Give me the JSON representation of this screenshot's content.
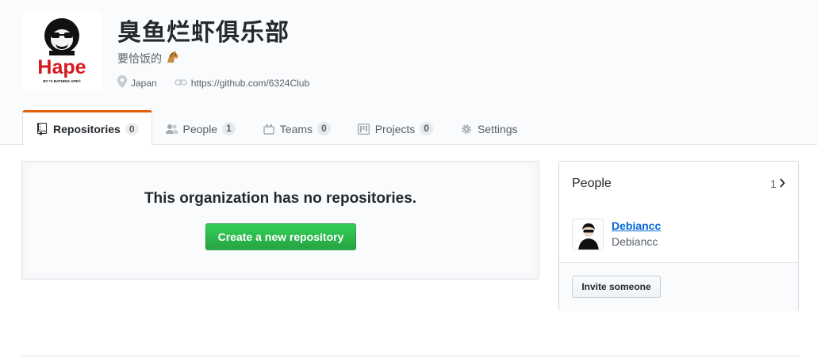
{
  "org": {
    "name": "臭鱼烂虾俱乐部",
    "description": "要恰饭的",
    "location": "Japan",
    "url": "https://github.com/6324Club",
    "avatar_brand": "Hape",
    "avatar_tagline": "BY *A BATHING APE®"
  },
  "tabs": [
    {
      "label": "Repositories",
      "count": "0",
      "icon": "repo-icon",
      "selected": true
    },
    {
      "label": "People",
      "count": "1",
      "icon": "people-icon",
      "selected": false
    },
    {
      "label": "Teams",
      "count": "0",
      "icon": "teams-icon",
      "selected": false
    },
    {
      "label": "Projects",
      "count": "0",
      "icon": "project-icon",
      "selected": false
    },
    {
      "label": "Settings",
      "count": null,
      "icon": "gear-icon",
      "selected": false
    }
  ],
  "blankslate": {
    "message": "This organization has no repositories.",
    "button_label": "Create a new repository"
  },
  "people": {
    "title": "People",
    "count": "1",
    "members": [
      {
        "login": "Debiancc",
        "name": "Debiancc"
      }
    ],
    "invite_label": "Invite someone"
  },
  "colors": {
    "accent_tab": "#e36209",
    "primary_button": "#28a745",
    "link": "#0366d6",
    "brand_red": "#d7191f"
  }
}
